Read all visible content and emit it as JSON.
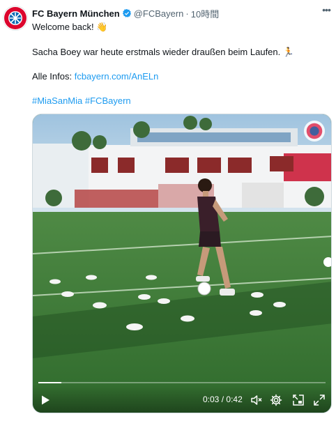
{
  "author": {
    "name": "FC Bayern München",
    "handle": "@FCBayern",
    "separator": "·",
    "time": "10時間"
  },
  "tweet": {
    "line1": "Welcome back! 👋",
    "line2": "Sacha Boey war heute erstmals wieder draußen beim Laufen. 🏃",
    "line3_prefix": "Alle Infos: ",
    "line3_link": "fcbayern.com/AnELn",
    "hashtag1": "#MiaSanMia",
    "hashtag2": "#FCBayern"
  },
  "video": {
    "current_time": "0:03",
    "time_separator": "/",
    "duration": "0:42",
    "progress_fraction": 0.08
  },
  "icons": {
    "more": "more-icon",
    "verified": "verified-icon",
    "play": "play-icon",
    "volume": "volume-muted-icon",
    "settings": "gear-icon",
    "pip": "picture-in-picture-icon",
    "fullscreen": "fullscreen-icon"
  },
  "colors": {
    "link": "#1d9bf0",
    "verified": "#1d9bf0",
    "brand_red": "#dc052d",
    "secondary_text": "#536471"
  }
}
